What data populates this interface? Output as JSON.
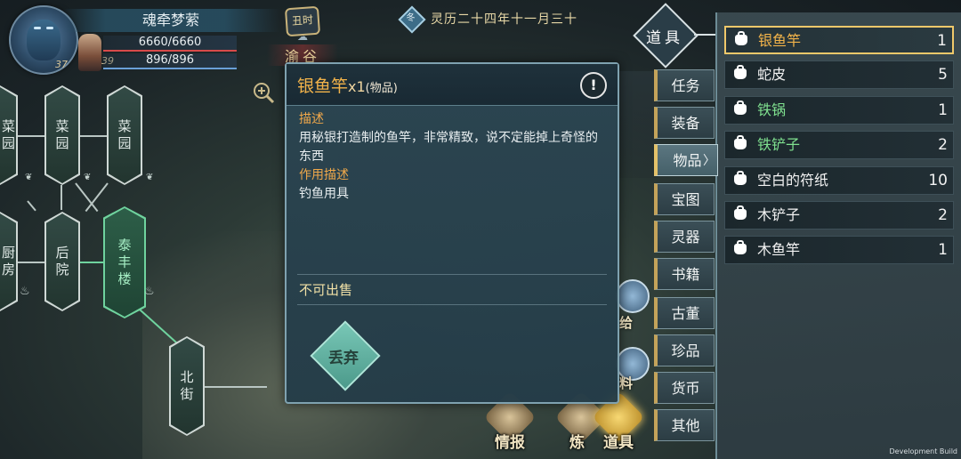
{
  "player": {
    "name": "魂牵梦萦",
    "level_main": "37",
    "level_partner": "39",
    "hp": "6660/6660",
    "mp": "896/896",
    "hp_fraction": 1.0,
    "mp_fraction": 1.0
  },
  "region": {
    "seal": "丑时",
    "name": "渝谷"
  },
  "date": {
    "gem_char": "冬",
    "text": "灵历二十四年十一月三十"
  },
  "map": {
    "nodes": [
      "菜园",
      "菜园",
      "菜园",
      "后院",
      "泰丰楼",
      "北街",
      "厨房"
    ],
    "active_node": "泰丰楼"
  },
  "popup": {
    "item_name": "银鱼竿",
    "quantity": "x1",
    "category": "(物品)",
    "info_icon": "!",
    "desc_label": "描述",
    "desc_text": "用秘银打造制的鱼竿，非常精致，说不定能掉上奇怪的东西",
    "effect_label": "作用描述",
    "effect_text": "钓鱼用具",
    "sell_status": "不可出售",
    "discard_label": "丢弃"
  },
  "behind_actions": {
    "give": "给",
    "material": "料"
  },
  "bottom_tabs": [
    {
      "label": "情报",
      "icon": "scroll-icon"
    },
    {
      "label": "炼",
      "icon": "furnace-icon"
    },
    {
      "label": "道具",
      "icon": "bag-icon"
    }
  ],
  "panel": {
    "title": "道具",
    "tabs": [
      "任务",
      "装备",
      "物品",
      "宝图",
      "灵器",
      "书籍",
      "古董",
      "珍品",
      "货币",
      "其他"
    ],
    "active_tab": "物品",
    "items": [
      {
        "name": "银鱼竿",
        "count": "1"
      },
      {
        "name": "蛇皮",
        "count": "5"
      },
      {
        "name": "铁锅",
        "count": "1"
      },
      {
        "name": "铁铲子",
        "count": "2"
      },
      {
        "name": "空白的符纸",
        "count": "10"
      },
      {
        "name": "木铲子",
        "count": "2"
      },
      {
        "name": "木鱼竿",
        "count": "1"
      }
    ]
  },
  "footer": {
    "build": "Development Build"
  },
  "colors": {
    "accent_gold": "#f2b34a",
    "green_item": "#7fe08f",
    "selected_border": "#f0c86a"
  }
}
